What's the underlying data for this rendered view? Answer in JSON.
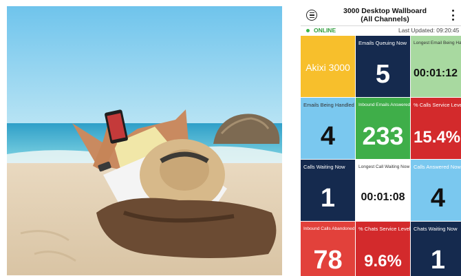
{
  "header": {
    "title_line1": "3000 Desktop Wallboard",
    "title_line2": "(All Channels)"
  },
  "status": {
    "online": "ONLINE",
    "last_updated": "Last Updated: 09:20:45"
  },
  "tiles": {
    "brand": {
      "name": "Akixi 3000",
      "color": "#f7bf2c"
    },
    "emails_queuing": {
      "label": "Emails Queuing Now",
      "value": "5",
      "color": "#152a4e"
    },
    "longest_email": {
      "label": "Longest Email Being Handled",
      "value": "00:01:12",
      "color": "#a8d9a0"
    },
    "emails_handled": {
      "label": "Emails Being Handled",
      "value": "4",
      "color": "#7ac8ef"
    },
    "inbound_answered": {
      "label": "Inbound Emails Answered",
      "value": "233",
      "color": "#3fae49"
    },
    "calls_service": {
      "label": "% Calls Service Level",
      "value": "15.4%",
      "color": "#d32a2c"
    },
    "calls_waiting": {
      "label": "Calls Waiting Now",
      "value": "1",
      "color": "#152a4e"
    },
    "longest_call": {
      "label": "Longest Call Waiting Now",
      "value": "00:01:08",
      "color": "#ffffff"
    },
    "calls_answered": {
      "label": "Calls Answered Now",
      "value": "4",
      "color": "#7ac8ef"
    },
    "calls_abandoned": {
      "label": "Inbound Calls Abandoned",
      "value": "78",
      "color": "#e2413b"
    },
    "chats_service": {
      "label": "% Chats Service Level",
      "value": "9.6%",
      "color": "#d32a2c"
    },
    "chats_waiting": {
      "label": "Chats Waiting Now",
      "value": "1",
      "color": "#152a4e"
    }
  },
  "icons": {
    "menu": "hamburger-circle-icon",
    "more": "kebab-icon"
  }
}
